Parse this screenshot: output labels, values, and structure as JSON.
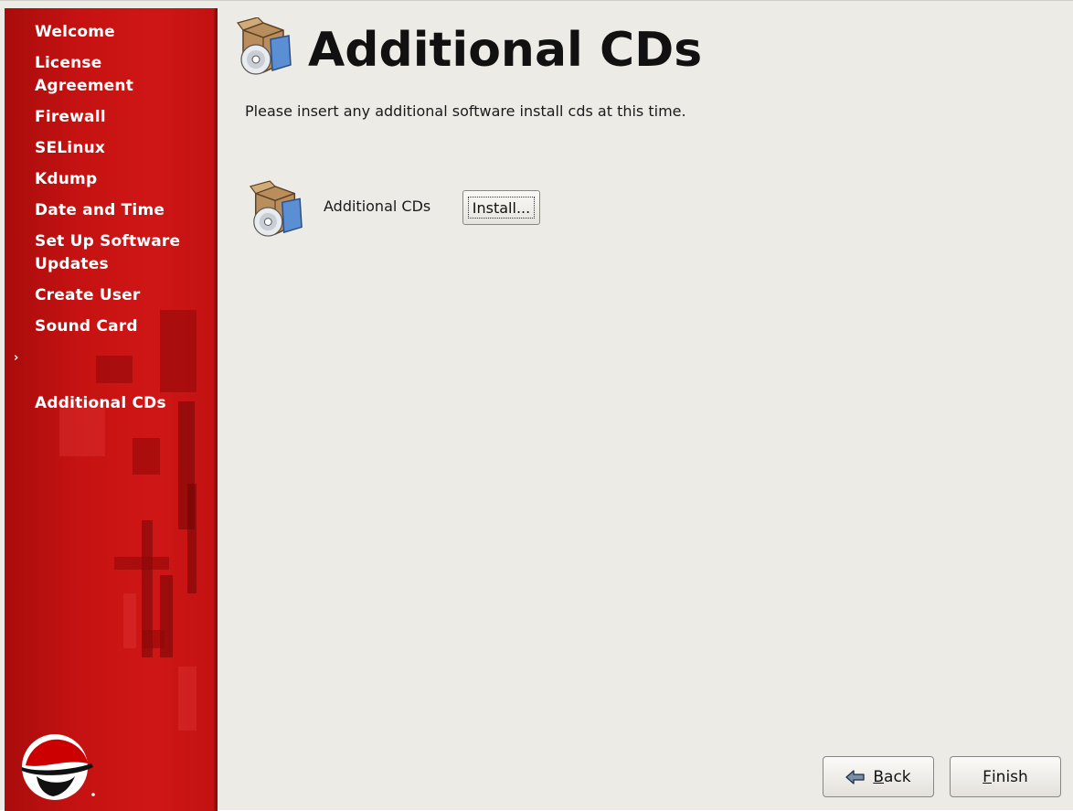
{
  "sidebar": {
    "steps": [
      {
        "label": "Welcome",
        "current": false
      },
      {
        "label": "License\nAgreement",
        "current": false
      },
      {
        "label": "Firewall",
        "current": false
      },
      {
        "label": "SELinux",
        "current": false
      },
      {
        "label": "Kdump",
        "current": false
      },
      {
        "label": "Date and Time",
        "current": false
      },
      {
        "label": "Set Up Software\nUpdates",
        "current": false
      },
      {
        "label": "Create User",
        "current": false
      },
      {
        "label": "Sound Card",
        "current": false
      },
      {
        "label": "Additional CDs",
        "current": true
      }
    ],
    "current_marker": "›",
    "logo_icon": "redhat-shadowman-icon",
    "colors": {
      "background": "#c61212",
      "text": "#ffffff"
    }
  },
  "main": {
    "title": "Additional CDs",
    "title_icon": "software-box-cd-icon",
    "intro": "Please insert any additional software install cds at this time.",
    "item": {
      "icon": "software-box-cd-icon",
      "label": "Additional CDs",
      "button_label": "Install..."
    }
  },
  "footer": {
    "back": {
      "mnemonic": "B",
      "rest": "ack",
      "icon": "back-arrow-icon"
    },
    "finish": {
      "mnemonic": "F",
      "rest": "inish"
    }
  }
}
